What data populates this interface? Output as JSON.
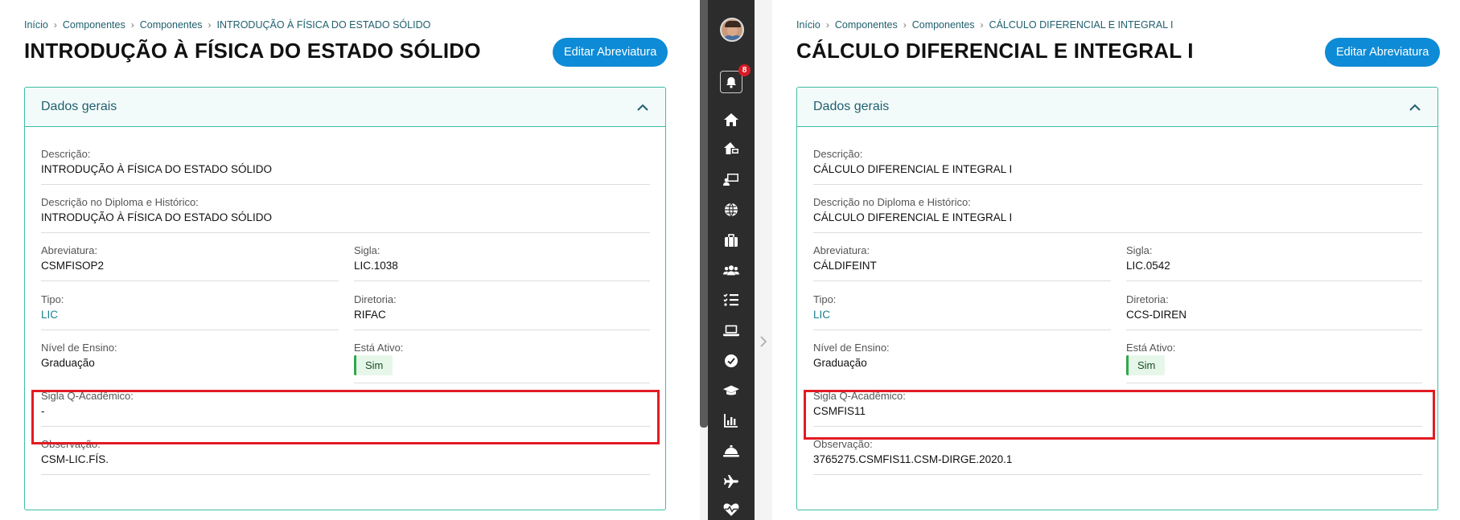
{
  "left": {
    "breadcrumb": [
      "Início",
      "Componentes",
      "Componentes",
      "INTRODUÇÃO À FÍSICA DO ESTADO SÓLIDO"
    ],
    "title": "INTRODUÇÃO À FÍSICA DO ESTADO SÓLIDO",
    "edit_button": "Editar Abreviatura",
    "card_title": "Dados gerais",
    "descricao_label": "Descrição:",
    "descricao": "INTRODUÇÃO À FÍSICA DO ESTADO SÓLIDO",
    "diploma_label": "Descrição no Diploma e Histórico:",
    "diploma": "INTRODUÇÃO À FÍSICA DO ESTADO SÓLIDO",
    "abreviatura_label": "Abreviatura:",
    "abreviatura": "CSMFISOP2",
    "sigla_label": "Sigla:",
    "sigla": "LIC.1038",
    "tipo_label": "Tipo:",
    "tipo": "LIC",
    "diretoria_label": "Diretoria:",
    "diretoria": "RIFAC",
    "nivel_label": "Nível de Ensino:",
    "nivel": "Graduação",
    "ativo_label": "Está Ativo:",
    "ativo": "Sim",
    "qacad_label": "Sigla Q-Acadêmico:",
    "qacad": "-",
    "obs_label": "Observação:",
    "obs": "CSM-LIC.FÍS."
  },
  "right": {
    "breadcrumb": [
      "Início",
      "Componentes",
      "Componentes",
      "CÁLCULO DIFERENCIAL E INTEGRAL I"
    ],
    "title": "CÁLCULO DIFERENCIAL E INTEGRAL I",
    "edit_button": "Editar Abreviatura",
    "card_title": "Dados gerais",
    "descricao_label": "Descrição:",
    "descricao": "CÁLCULO DIFERENCIAL E INTEGRAL I",
    "diploma_label": "Descrição no Diploma e Histórico:",
    "diploma": "CÁLCULO DIFERENCIAL E INTEGRAL I",
    "abreviatura_label": "Abreviatura:",
    "abreviatura": "CÁLDIFEINT",
    "sigla_label": "Sigla:",
    "sigla": "LIC.0542",
    "tipo_label": "Tipo:",
    "tipo": "LIC",
    "diretoria_label": "Diretoria:",
    "diretoria": "CCS-DIREN",
    "nivel_label": "Nível de Ensino:",
    "nivel": "Graduação",
    "ativo_label": "Está Ativo:",
    "ativo": "Sim",
    "qacad_label": "Sigla Q-Acadêmico:",
    "qacad": "CSMFIS11",
    "obs_label": "Observação:",
    "obs": "3765275.CSMFIS11.CSM-DIRGE.2020.1"
  },
  "sidebar": {
    "notification_count": "8",
    "icons": [
      "home-icon",
      "home-device-icon",
      "presentation-icon",
      "globe-icon",
      "briefcase-icon",
      "users-icon",
      "checklist-icon",
      "laptop-icon",
      "check-circle-icon",
      "graduation-cap-icon",
      "chart-icon",
      "service-bell-icon",
      "airplane-icon",
      "heart-pulse-icon"
    ]
  },
  "colors": {
    "accent": "#0d8bd6",
    "card_border": "#3ebea3",
    "highlight": "#e21b23",
    "sidebar": "#2c2c2c",
    "active_badge": "#2ea84a"
  }
}
